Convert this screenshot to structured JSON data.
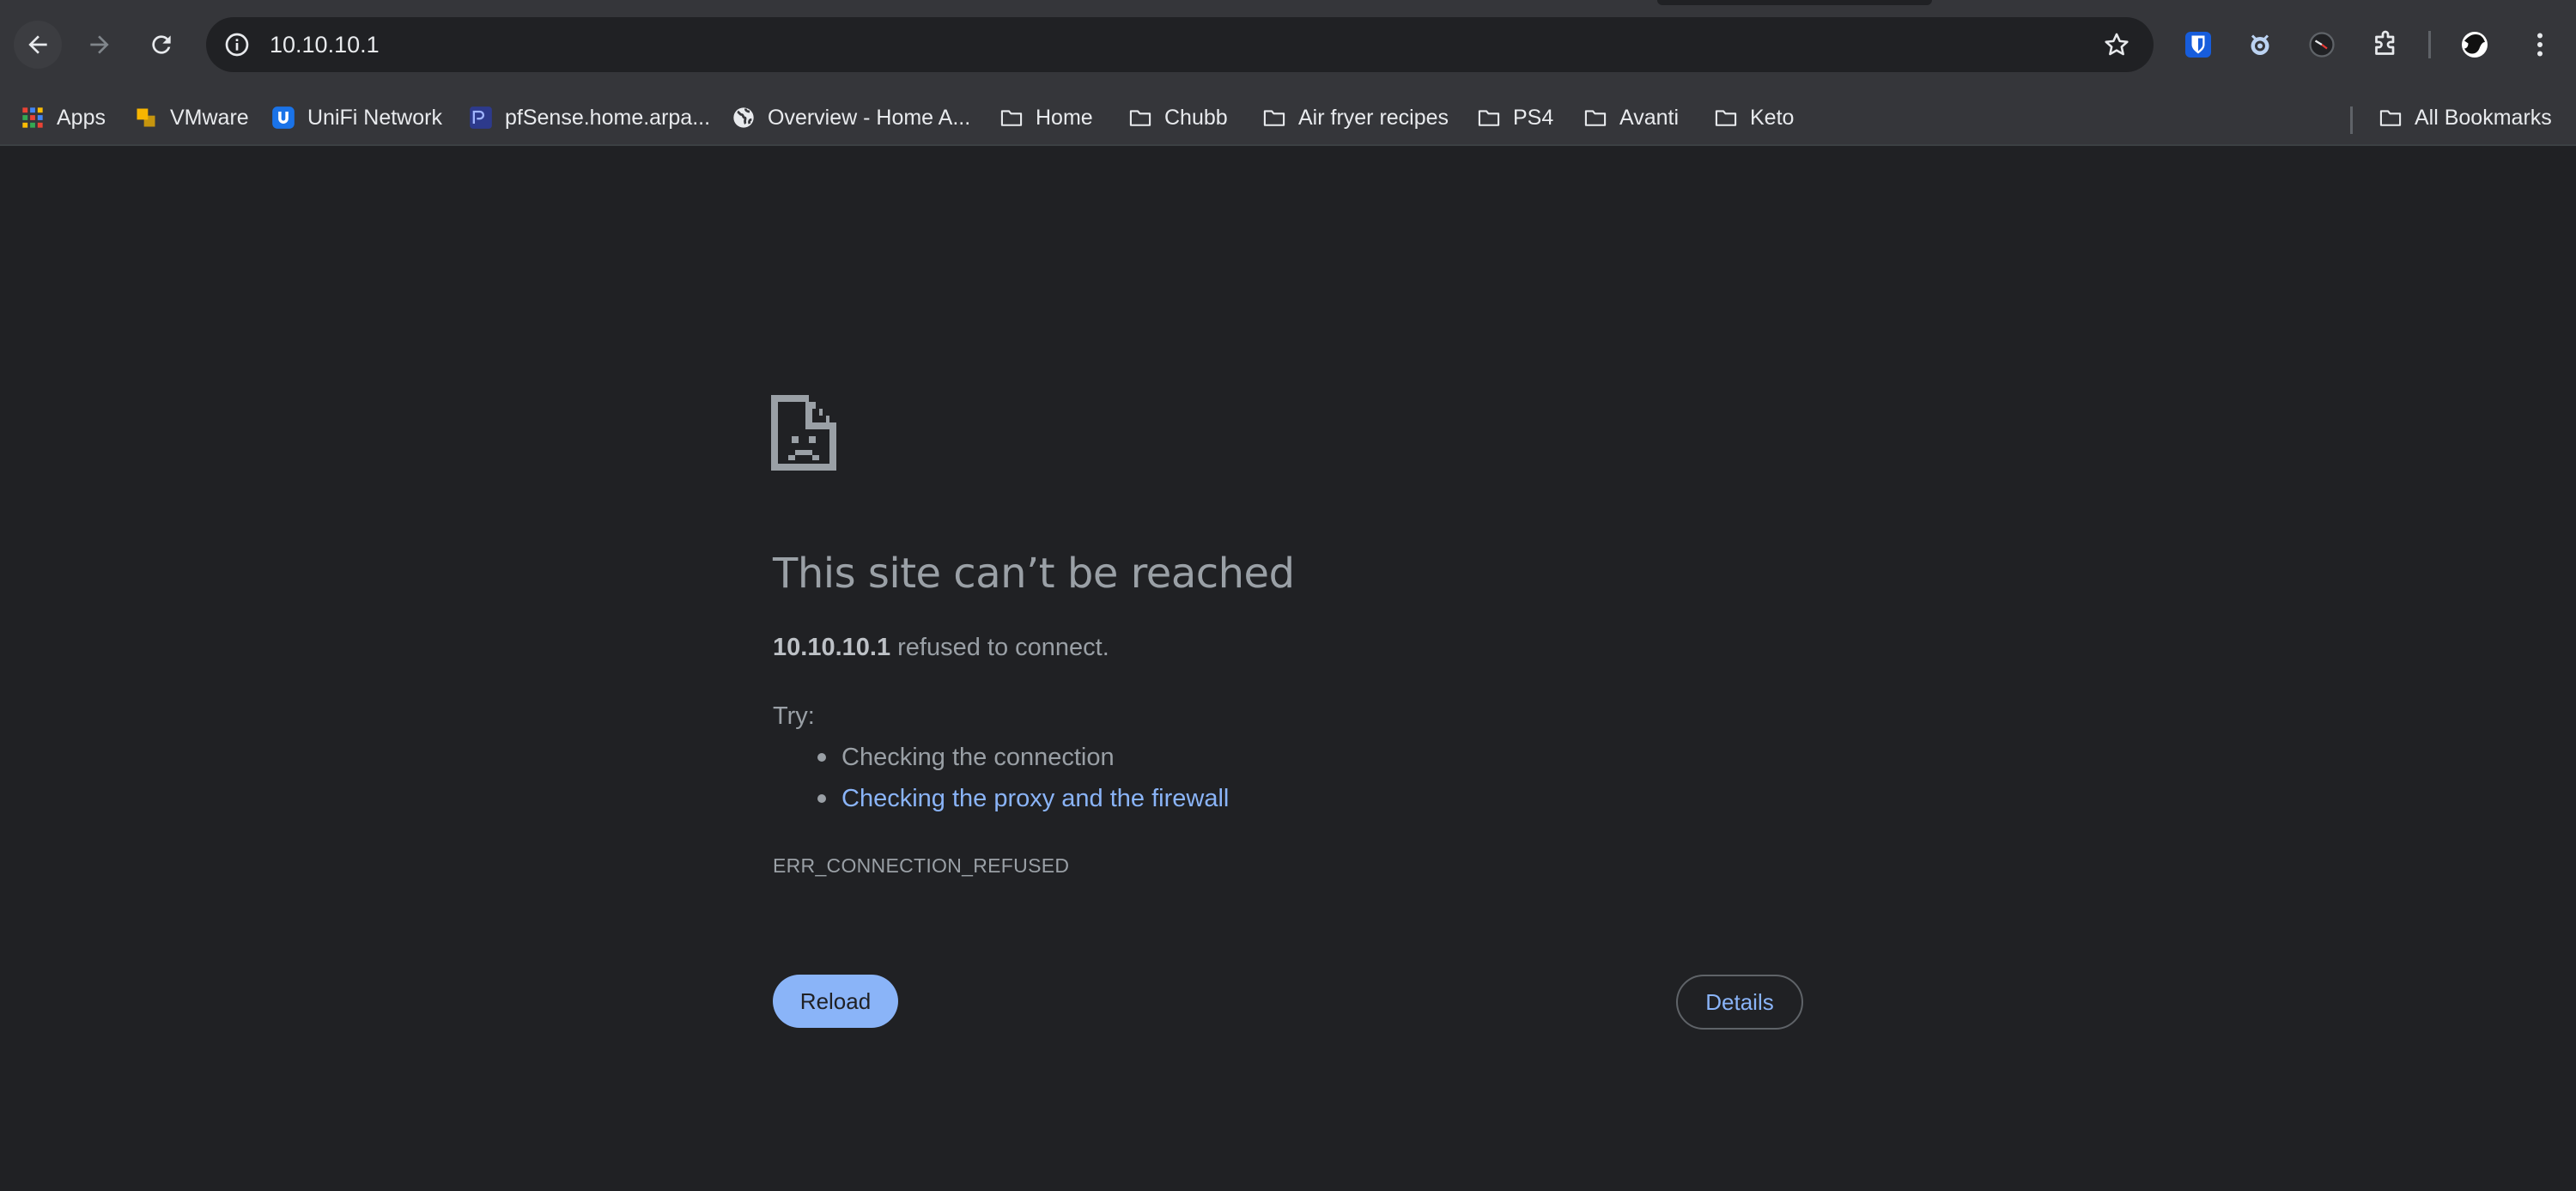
{
  "browser": {
    "omnibox": {
      "url": "10.10.10.1"
    },
    "nav": {
      "back": "back-arrow-icon",
      "forward": "forward-arrow-icon",
      "reload": "reload-icon"
    },
    "extensions": [
      "bitwarden-icon",
      "bug-icon",
      "clock-icon",
      "puzzle-icon",
      "avatar"
    ]
  },
  "bookmarks": {
    "items": [
      {
        "label": "Apps",
        "icon": "apps-grid-icon"
      },
      {
        "label": "VMware",
        "icon": "vmware-icon"
      },
      {
        "label": "UniFi Network",
        "icon": "unifi-icon"
      },
      {
        "label": "pfSense.home.arpa...",
        "icon": "pfsense-icon"
      },
      {
        "label": "Overview - Home A...",
        "icon": "globe-icon"
      },
      {
        "label": "Home",
        "icon": "folder-icon"
      },
      {
        "label": "Chubb",
        "icon": "folder-icon"
      },
      {
        "label": "Air fryer recipes",
        "icon": "folder-icon"
      },
      {
        "label": "PS4",
        "icon": "folder-icon"
      },
      {
        "label": "Avanti",
        "icon": "folder-icon"
      },
      {
        "label": "Keto",
        "icon": "folder-icon"
      }
    ],
    "all_bookmarks": "All Bookmarks"
  },
  "error": {
    "icon": "sad-document-icon",
    "title": "This site can’t be reached",
    "host": "10.10.10.1",
    "message": "refused to connect.",
    "try_label": "Try:",
    "suggestions": [
      {
        "text": "Checking the connection"
      },
      {
        "text": "Checking the proxy and the firewall"
      }
    ],
    "code": "ERR_CONNECTION_REFUSED",
    "reload_label": "Reload",
    "details_label": "Details"
  },
  "colors": {
    "page_bg": "#202124",
    "toolbar_bg": "#35363a",
    "accent": "#8ab4f8",
    "text_muted": "#9aa0a6",
    "text_primary": "#e8eaed"
  }
}
